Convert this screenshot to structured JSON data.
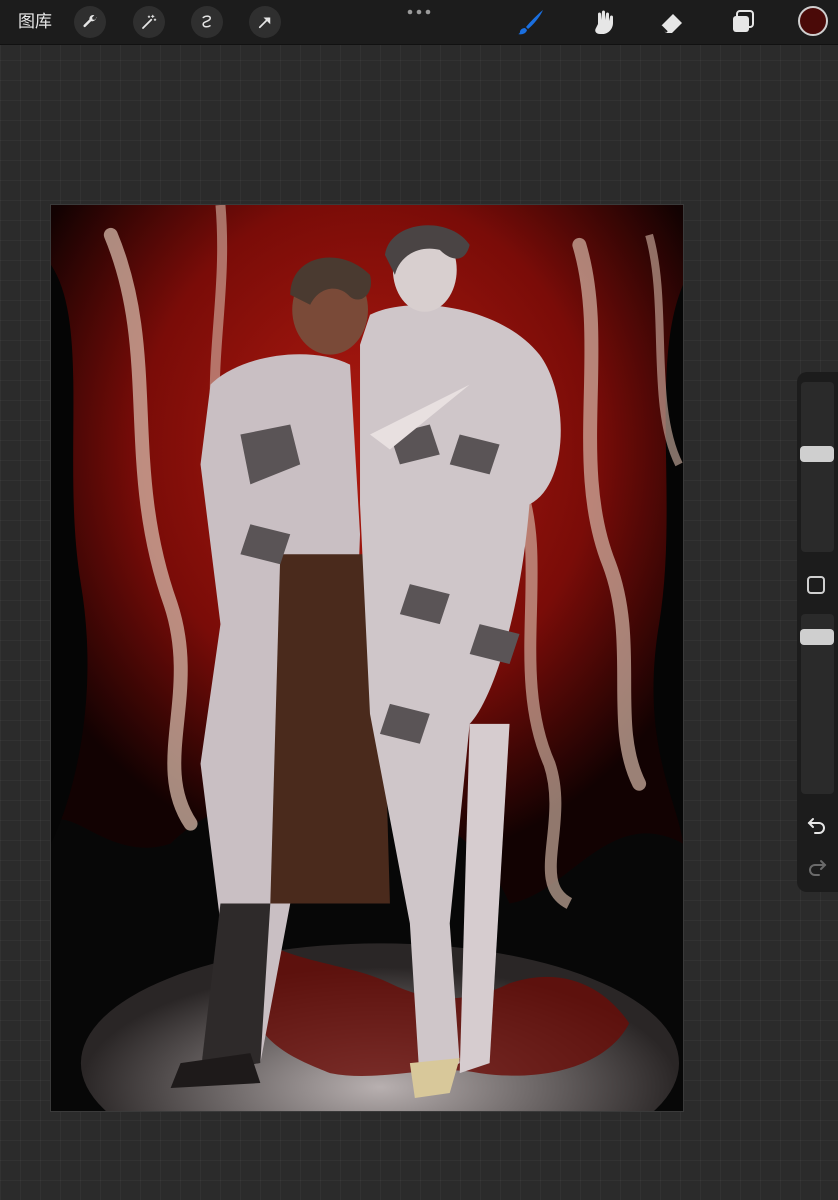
{
  "topbar": {
    "gallery_label": "图库",
    "left_tools": [
      "wrench-icon",
      "magic-wand-icon",
      "selection-icon",
      "transform-arrow-icon"
    ],
    "right_tools": [
      "brush-icon",
      "smudge-icon",
      "eraser-icon",
      "layers-icon"
    ],
    "active_tool": "brush-icon",
    "current_color": "#4a0a08",
    "active_color": "#1a6fe0"
  },
  "sidebar": {
    "brush_size_level": 0.35,
    "opacity_level": 0.15,
    "icons": [
      "modify-square-icon",
      "undo-icon",
      "redo-icon"
    ]
  },
  "canvas": {
    "palette": {
      "background": "#070707",
      "curtain_red": "#8a0e0a",
      "curtain_highlight": "#b01a10",
      "uniform_light": "#c9bfc3",
      "uniform_shadow": "#5a5456",
      "apron_brown": "#4a2a1c",
      "skin": "#7a4a38",
      "hair": "#4a3a30",
      "floor": "#9a9090"
    }
  }
}
